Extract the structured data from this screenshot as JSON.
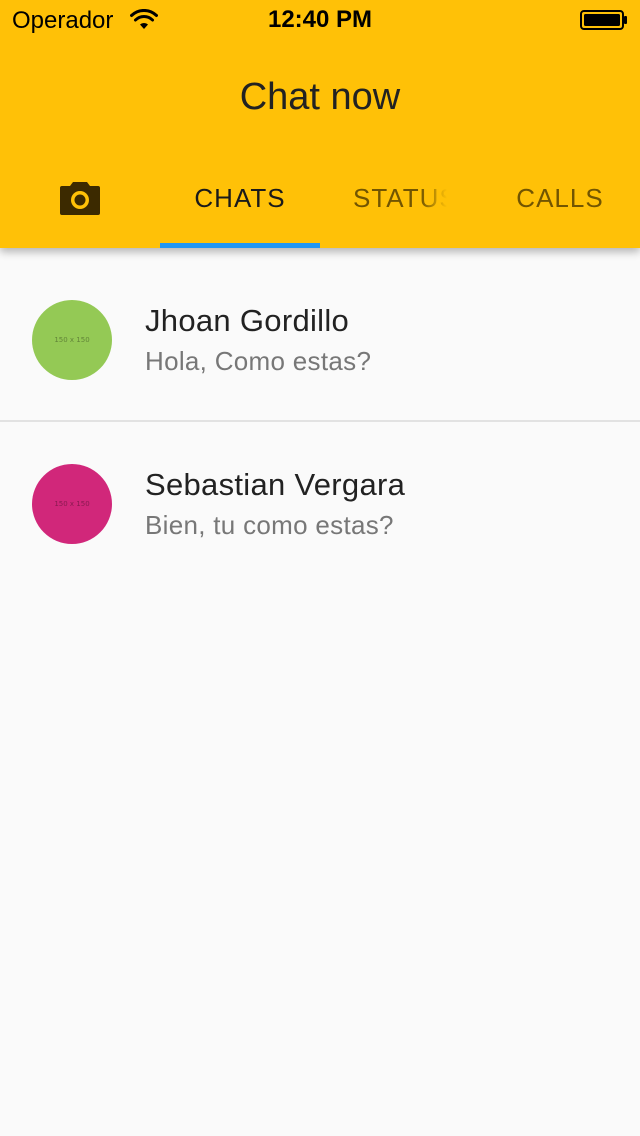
{
  "status_bar": {
    "carrier": "Operador",
    "time": "12:40 PM",
    "wifi_icon": "wifi-icon",
    "battery_icon": "battery-full-icon"
  },
  "app_bar": {
    "title": "Chat now",
    "background_color": "#ffc107"
  },
  "tabs": {
    "camera_icon": "camera-icon",
    "items": [
      {
        "label": "CHATS",
        "active": true
      },
      {
        "label": "STATUS",
        "active": false
      },
      {
        "label": "CALLS",
        "active": false
      }
    ],
    "indicator_color": "#2196f3"
  },
  "chats": [
    {
      "name": "Jhoan Gordillo",
      "message": "Hola, Como estas?",
      "avatar_text": "150 x 150",
      "avatar_color": "#94c955"
    },
    {
      "name": "Sebastian Vergara",
      "message": "Bien, tu como estas?",
      "avatar_text": "150 x 150",
      "avatar_color": "#d1277a"
    }
  ]
}
